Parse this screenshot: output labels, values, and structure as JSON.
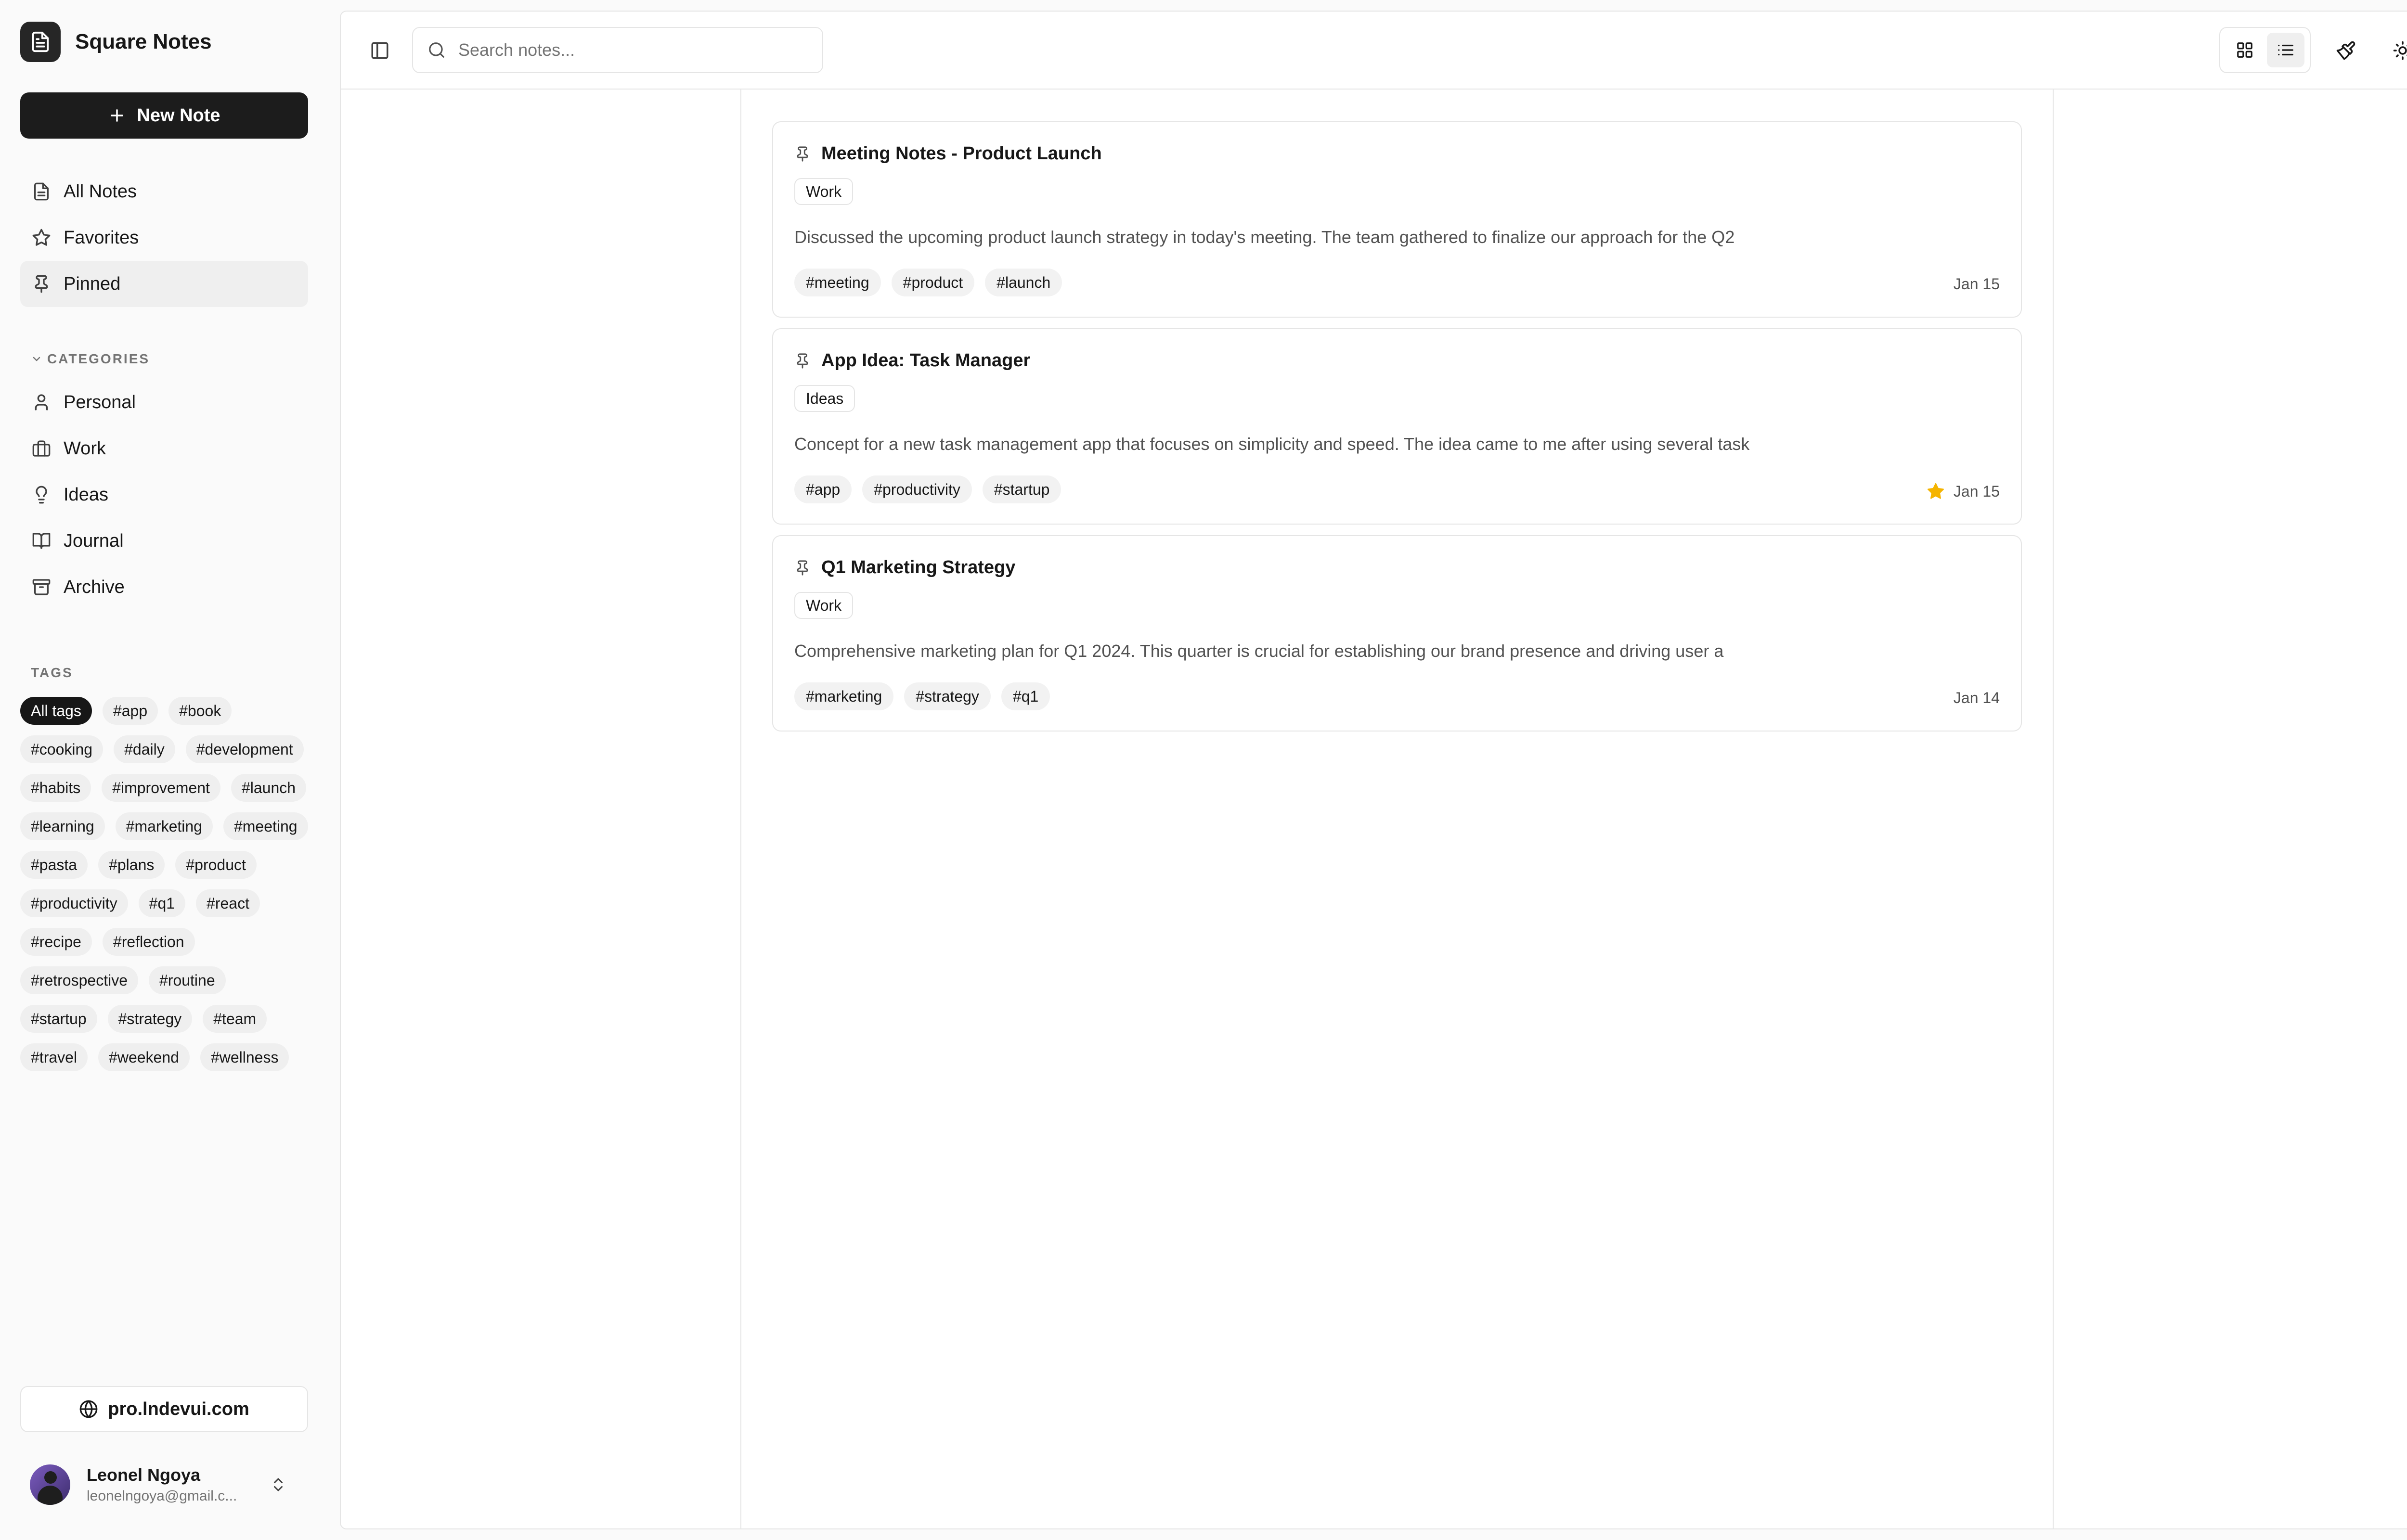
{
  "app": {
    "name": "Square Notes"
  },
  "actions": {
    "new_note": "New Note"
  },
  "nav": [
    {
      "label": "All Notes",
      "icon": "file-text-icon"
    },
    {
      "label": "Favorites",
      "icon": "star-icon"
    },
    {
      "label": "Pinned",
      "icon": "pin-icon",
      "active": true
    }
  ],
  "categories": {
    "title": "CATEGORIES",
    "items": [
      {
        "label": "Personal",
        "icon": "user-icon"
      },
      {
        "label": "Work",
        "icon": "briefcase-icon"
      },
      {
        "label": "Ideas",
        "icon": "lightbulb-icon"
      },
      {
        "label": "Journal",
        "icon": "book-open-icon"
      },
      {
        "label": "Archive",
        "icon": "archive-icon"
      }
    ]
  },
  "tags": {
    "title": "TAGS",
    "items": [
      "All tags",
      "#app",
      "#book",
      "#cooking",
      "#daily",
      "#development",
      "#habits",
      "#improvement",
      "#launch",
      "#learning",
      "#marketing",
      "#meeting",
      "#pasta",
      "#plans",
      "#product",
      "#productivity",
      "#q1",
      "#react",
      "#recipe",
      "#reflection",
      "#retrospective",
      "#routine",
      "#startup",
      "#strategy",
      "#team",
      "#travel",
      "#weekend",
      "#wellness"
    ],
    "active": "All tags"
  },
  "footer": {
    "site_label": "pro.lndevui.com",
    "user_name": "Leonel Ngoya",
    "user_email": "leonelngoya@gmail.c..."
  },
  "search": {
    "placeholder": "Search notes..."
  },
  "colors": {
    "accent": "#171717",
    "star": "#f5b400",
    "border": "#e5e5e5"
  },
  "notes": [
    {
      "title": "Meeting Notes - Product Launch",
      "category": "Work",
      "excerpt": "Discussed the upcoming product launch strategy in today's meeting. The team gathered to finalize our approach for the Q2",
      "tags": [
        "#meeting",
        "#product",
        "#launch"
      ],
      "date": "Jan 15",
      "favorite": false
    },
    {
      "title": "App Idea: Task Manager",
      "category": "Ideas",
      "excerpt": "Concept for a new task management app that focuses on simplicity and speed. The idea came to me after using several task",
      "tags": [
        "#app",
        "#productivity",
        "#startup"
      ],
      "date": "Jan 15",
      "favorite": true
    },
    {
      "title": "Q1 Marketing Strategy",
      "category": "Work",
      "excerpt": "Comprehensive marketing plan for Q1 2024. This quarter is crucial for establishing our brand presence and driving user a",
      "tags": [
        "#marketing",
        "#strategy",
        "#q1"
      ],
      "date": "Jan 14",
      "favorite": false
    }
  ]
}
